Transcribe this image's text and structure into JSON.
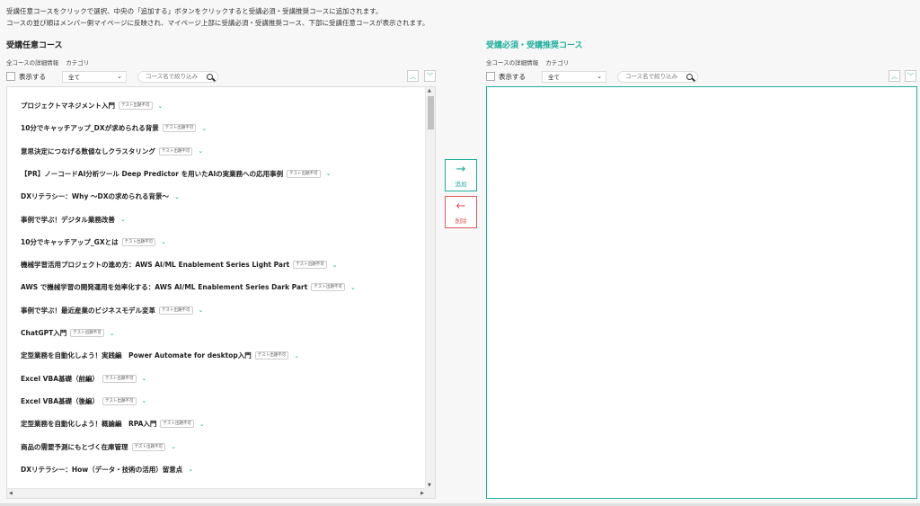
{
  "intro": {
    "line1": "受講任意コースをクリックで選択、中央の「追加する」ボタンをクリックすると受講必須・受講推奨コースに追加されます。",
    "line2": "コースの並び順はメンバー側マイページに反映され、マイページ上部に受講必須・受講推奨コース、下部に受講任意コースが表示されます。"
  },
  "left": {
    "title": "受講任意コース",
    "meta_detail": "全コースの詳細情報",
    "meta_category": "カテゴリ",
    "show_label": "表示する",
    "select_value": "全て",
    "search_placeholder": "コース名で絞り込み"
  },
  "right": {
    "title": "受講必須・受講推奨コース",
    "meta_detail": "全コースの詳細情報",
    "meta_category": "カテゴリ",
    "show_label": "表示する",
    "select_value": "全て",
    "search_placeholder": "コース名で絞り込み"
  },
  "buttons": {
    "add_label": "追加",
    "delete_label": "削除"
  },
  "icons": {
    "sort_up": "chevron-up-icon",
    "sort_down": "chevron-down-icon",
    "search": "search-icon",
    "add": "arrow-right-icon",
    "delete": "arrow-left-icon"
  },
  "colors": {
    "accent": "#1fae9c",
    "danger": "#e05a5a"
  },
  "courses": [
    {
      "name": "プロジェクトマネジメント入門",
      "badge": "テスト出題不可"
    },
    {
      "name": "10分でキャッチアップ_DXが求められる背景",
      "badge": "テスト出題不可"
    },
    {
      "name": "意思決定につなげる数値なしクラスタリング",
      "badge": "テスト出題不可"
    },
    {
      "name": "【PR】ノーコードAI分析ツール Deep Predictor を用いたAIの実業務への応用事例",
      "badge": "テスト出題不可"
    },
    {
      "name": "DXリテラシー：Why ～DXの求められる背景～",
      "badge": ""
    },
    {
      "name": "事例で学ぶ！デジタル業務改善",
      "badge": ""
    },
    {
      "name": "10分でキャッチアップ_GXとは",
      "badge": "テスト出題不可"
    },
    {
      "name": "機械学習活用プロジェクトの進め方：AWS AI/ML Enablement Series Light Part",
      "badge": "テスト出題不可"
    },
    {
      "name": "AWS で機械学習の開発運用を効率化する：AWS AI/ML Enablement Series Dark Part",
      "badge": "テスト出題不可"
    },
    {
      "name": "事例で学ぶ！最近産業のビジネスモデル変革",
      "badge": "テスト出題不可"
    },
    {
      "name": "ChatGPT入門",
      "badge": "テスト出題不可"
    },
    {
      "name": "定型業務を自動化しよう！実践編　Power Automate for desktop入門",
      "badge": "テスト出題不可"
    },
    {
      "name": "Excel VBA基礎（前編）",
      "badge": "テスト出題不可"
    },
    {
      "name": "Excel VBA基礎（後編）",
      "badge": "テスト出題不可"
    },
    {
      "name": "定型業務を自動化しよう！概論編　RPA入門",
      "badge": "テスト出題不可"
    },
    {
      "name": "商品の需要予測にもとづく在庫管理",
      "badge": "テスト出題不可"
    },
    {
      "name": "DXリテラシー：How（データ・技術の活用）留意点",
      "badge": ""
    }
  ]
}
